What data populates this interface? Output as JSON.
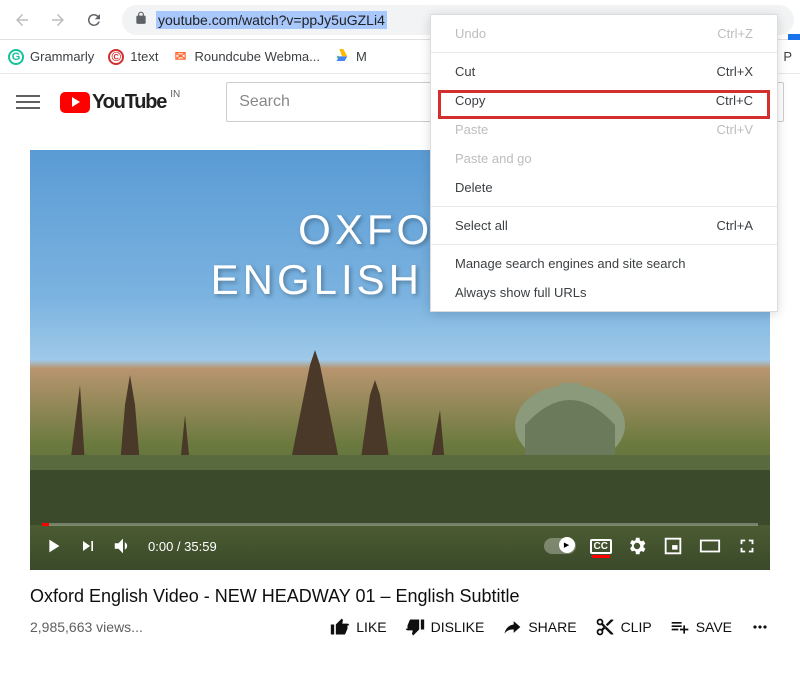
{
  "browser": {
    "url": "youtube.com/watch?v=ppJy5uGZLi4"
  },
  "bookmarks": {
    "grammarly": "Grammarly",
    "onetext": "1text",
    "roundcube": "Roundcube Webma...",
    "m": "M",
    "p": "P"
  },
  "youtube": {
    "brand": "YouTube",
    "country": "IN",
    "search_placeholder": "Search"
  },
  "video": {
    "overlay_line1": "OXFORD",
    "overlay_line2": "ENGLISH VIDEO",
    "time_current": "0:00",
    "time_total": "35:59",
    "cc": "CC",
    "title": "Oxford English Video - NEW HEADWAY 01 – English Subtitle",
    "views": "2,985,663 views...",
    "actions": {
      "like": "LIKE",
      "dislike": "DISLIKE",
      "share": "SHARE",
      "clip": "CLIP",
      "save": "SAVE"
    }
  },
  "context_menu": {
    "undo": {
      "label": "Undo",
      "shortcut": "Ctrl+Z"
    },
    "cut": {
      "label": "Cut",
      "shortcut": "Ctrl+X"
    },
    "copy": {
      "label": "Copy",
      "shortcut": "Ctrl+C"
    },
    "paste": {
      "label": "Paste",
      "shortcut": "Ctrl+V"
    },
    "paste_go": {
      "label": "Paste and go",
      "shortcut": ""
    },
    "delete": {
      "label": "Delete",
      "shortcut": ""
    },
    "select_all": {
      "label": "Select all",
      "shortcut": "Ctrl+A"
    },
    "manage": {
      "label": "Manage search engines and site search",
      "shortcut": ""
    },
    "full_urls": {
      "label": "Always show full URLs",
      "shortcut": ""
    }
  }
}
